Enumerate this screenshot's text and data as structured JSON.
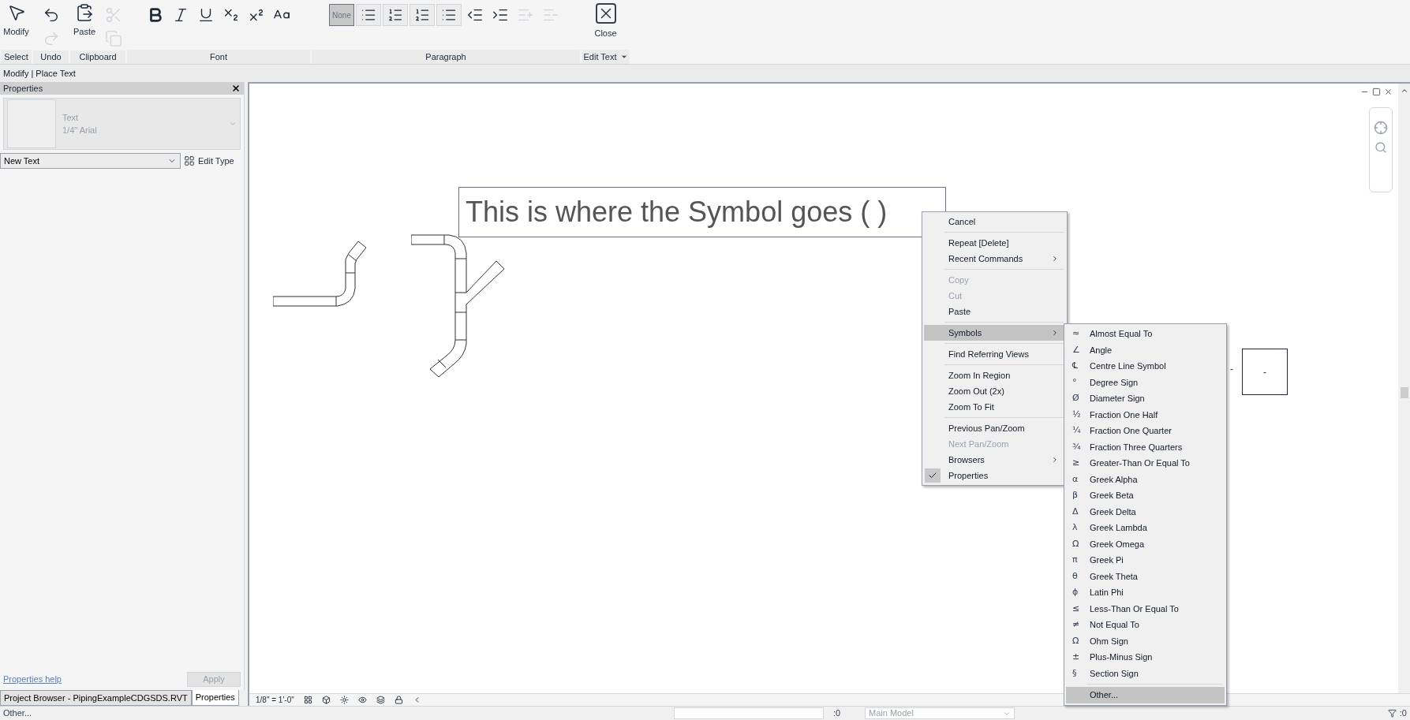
{
  "ribbon": {
    "groups": [
      {
        "label": "Select",
        "buttons": [
          {
            "kind": "pointer",
            "label": "Modify",
            "disabled": false
          }
        ]
      },
      {
        "label": "Undo",
        "buttons": [
          {
            "kind": "undo",
            "disabled": false
          },
          {
            "kind": "redo",
            "disabled": true
          }
        ]
      },
      {
        "label": "Clipboard",
        "buttons": [
          {
            "kind": "paste",
            "label": "Paste",
            "disabled": false
          },
          {
            "kind": "cut",
            "disabled": true
          },
          {
            "kind": "copy",
            "disabled": true
          }
        ]
      },
      {
        "label": "Font",
        "buttons": [
          {
            "kind": "bold",
            "disabled": false
          },
          {
            "kind": "italic",
            "disabled": false
          },
          {
            "kind": "underline",
            "disabled": false
          },
          {
            "kind": "subscript",
            "disabled": false
          },
          {
            "kind": "superscript",
            "disabled": false
          },
          {
            "kind": "case",
            "disabled": false
          }
        ]
      },
      {
        "label": "Paragraph",
        "buttons": [
          {
            "kind": "none",
            "label": "None",
            "selected": true,
            "disabled": false
          },
          {
            "kind": "bullets",
            "selected": false,
            "disabled": false
          },
          {
            "kind": "numbers",
            "selected": false,
            "disabled": false
          },
          {
            "kind": "letters",
            "selected": false,
            "disabled": false
          },
          {
            "kind": "lower",
            "selected": false,
            "disabled": false
          },
          {
            "kind": "outdent",
            "disabled": false
          },
          {
            "kind": "indent",
            "disabled": false
          },
          {
            "kind": "increase",
            "disabled": true
          },
          {
            "kind": "decrease",
            "disabled": true
          }
        ]
      },
      {
        "label": "Edit Text",
        "dropdown": true,
        "buttons": [
          {
            "kind": "close",
            "label": "Close",
            "disabled": false
          }
        ]
      }
    ]
  },
  "context_bar": "Modify | Place Text",
  "properties": {
    "title": "Properties",
    "type_name": "Text",
    "type_detail": "1/4\" Arial",
    "instance": "New Text",
    "edit_type": "Edit Type",
    "help": "Properties help",
    "apply": "Apply",
    "apply_disabled": true
  },
  "bottom_tabs": [
    {
      "label": "Project Browser - PipingExampleCDGSDS.RVT",
      "selected": false
    },
    {
      "label": "Properties",
      "selected": true
    }
  ],
  "canvas": {
    "text": "This is where the Symbol goes ( )",
    "tag_labels": [
      "-",
      "-"
    ]
  },
  "context_menu": [
    {
      "kind": "item",
      "label": "Cancel",
      "disabled": false,
      "submenu": false,
      "checked": false,
      "selected": false
    },
    {
      "kind": "separator"
    },
    {
      "kind": "item",
      "label": "Repeat [Delete]",
      "disabled": false,
      "submenu": false,
      "checked": false,
      "selected": false
    },
    {
      "kind": "item",
      "label": "Recent Commands",
      "disabled": false,
      "submenu": true,
      "checked": false,
      "selected": false
    },
    {
      "kind": "separator"
    },
    {
      "kind": "item",
      "label": "Copy",
      "disabled": true,
      "submenu": false,
      "checked": false,
      "selected": false
    },
    {
      "kind": "item",
      "label": "Cut",
      "disabled": true,
      "submenu": false,
      "checked": false,
      "selected": false
    },
    {
      "kind": "item",
      "label": "Paste",
      "disabled": false,
      "submenu": false,
      "checked": false,
      "selected": false
    },
    {
      "kind": "separator"
    },
    {
      "kind": "item",
      "label": "Symbols",
      "disabled": false,
      "submenu": true,
      "checked": false,
      "selected": true
    },
    {
      "kind": "separator"
    },
    {
      "kind": "item",
      "label": "Find Referring Views",
      "disabled": false,
      "submenu": false,
      "checked": false,
      "selected": false
    },
    {
      "kind": "separator"
    },
    {
      "kind": "item",
      "label": "Zoom In Region",
      "disabled": false,
      "submenu": false,
      "checked": false,
      "selected": false
    },
    {
      "kind": "item",
      "label": "Zoom Out (2x)",
      "disabled": false,
      "submenu": false,
      "checked": false,
      "selected": false
    },
    {
      "kind": "item",
      "label": "Zoom To Fit",
      "disabled": false,
      "submenu": false,
      "checked": false,
      "selected": false
    },
    {
      "kind": "separator"
    },
    {
      "kind": "item",
      "label": "Previous Pan/Zoom",
      "disabled": false,
      "submenu": false,
      "checked": false,
      "selected": false
    },
    {
      "kind": "item",
      "label": "Next Pan/Zoom",
      "disabled": true,
      "submenu": false,
      "checked": false,
      "selected": false
    },
    {
      "kind": "item",
      "label": "Browsers",
      "disabled": false,
      "submenu": true,
      "checked": false,
      "selected": false
    },
    {
      "kind": "item",
      "label": "Properties",
      "disabled": false,
      "submenu": false,
      "checked": true,
      "selected": false
    }
  ],
  "symbols_menu": [
    {
      "kind": "item",
      "symbol": "≈",
      "label": "Almost Equal To",
      "selected": false
    },
    {
      "kind": "item",
      "symbol": "∠",
      "label": "Angle",
      "selected": false
    },
    {
      "kind": "item",
      "symbol": "℄",
      "label": "Centre Line Symbol",
      "selected": false
    },
    {
      "kind": "item",
      "symbol": "°",
      "label": "Degree Sign",
      "selected": false
    },
    {
      "kind": "item",
      "symbol": "Ø",
      "label": "Diameter Sign",
      "selected": false
    },
    {
      "kind": "item",
      "symbol": "½",
      "label": "Fraction One Half",
      "selected": false
    },
    {
      "kind": "item",
      "symbol": "¼",
      "label": "Fraction One Quarter",
      "selected": false
    },
    {
      "kind": "item",
      "symbol": "¾",
      "label": "Fraction Three Quarters",
      "selected": false
    },
    {
      "kind": "item",
      "symbol": "≥",
      "label": "Greater-Than Or Equal To",
      "selected": false
    },
    {
      "kind": "item",
      "symbol": "α",
      "label": "Greek Alpha",
      "selected": false
    },
    {
      "kind": "item",
      "symbol": "β",
      "label": "Greek Beta",
      "selected": false
    },
    {
      "kind": "item",
      "symbol": "Δ",
      "label": "Greek Delta",
      "selected": false
    },
    {
      "kind": "item",
      "symbol": "λ",
      "label": "Greek Lambda",
      "selected": false
    },
    {
      "kind": "item",
      "symbol": "Ω",
      "label": "Greek Omega",
      "selected": false
    },
    {
      "kind": "item",
      "symbol": "π",
      "label": "Greek Pi",
      "selected": false
    },
    {
      "kind": "item",
      "symbol": "θ",
      "label": "Greek Theta",
      "selected": false
    },
    {
      "kind": "item",
      "symbol": "ɸ",
      "label": "Latin Phi",
      "selected": false
    },
    {
      "kind": "item",
      "symbol": "≤",
      "label": "Less-Than Or Equal To",
      "selected": false
    },
    {
      "kind": "item",
      "symbol": "≠",
      "label": "Not Equal To",
      "selected": false
    },
    {
      "kind": "item",
      "symbol": "Ω",
      "label": "Ohm Sign",
      "selected": false
    },
    {
      "kind": "item",
      "symbol": "±",
      "label": "Plus-Minus Sign",
      "selected": false
    },
    {
      "kind": "item",
      "symbol": "§",
      "label": "Section Sign",
      "selected": false
    },
    {
      "kind": "separator"
    },
    {
      "kind": "item",
      "label": "Other...",
      "selected": true
    }
  ],
  "view_bar": {
    "scale": "1/8\" = 1'-0\""
  },
  "status_bar": {
    "message": "Other...",
    "count_left": ":0",
    "model": "Main Model",
    "count_right": ":0"
  }
}
